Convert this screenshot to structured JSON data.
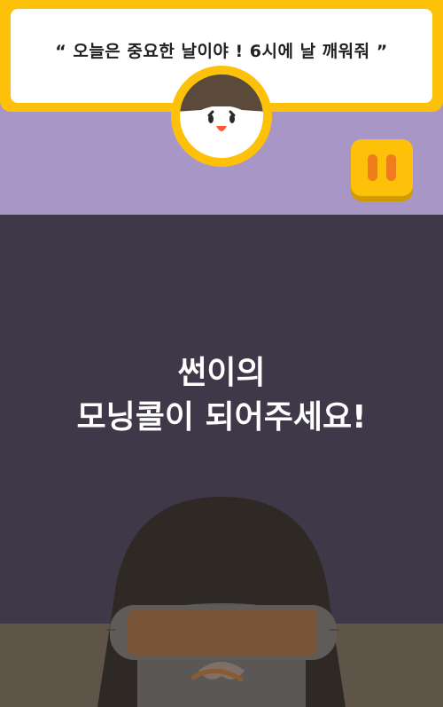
{
  "speech": {
    "text": "“ 오늘은 중요한 날이야 ! 6시에 날 깨워줘 ”"
  },
  "pause_button": {
    "icon": "pause-icon"
  },
  "title": {
    "line1": "썬이의",
    "line2": "모닝콜이 되어주세요!"
  },
  "colors": {
    "accent_yellow": "#fdc10a",
    "top_purple": "#a896c6",
    "dark_bg": "#3e3848",
    "pause_orange": "#f07c1c"
  }
}
